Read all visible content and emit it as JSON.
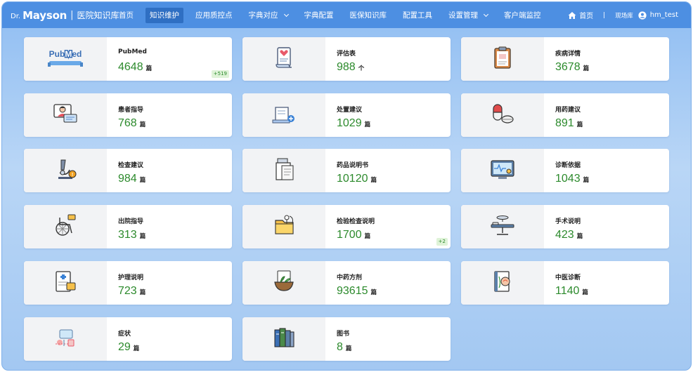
{
  "app": {
    "logo_dr": "Dr.",
    "logo_brand": "Mayson",
    "logo_sep": "|",
    "logo_subtitle": "医院知识库"
  },
  "nav": [
    {
      "label": "首页",
      "active": false,
      "dropdown": false
    },
    {
      "label": "知识维护",
      "active": true,
      "dropdown": false
    },
    {
      "label": "应用质控点",
      "active": false,
      "dropdown": false
    },
    {
      "label": "字典对应",
      "active": false,
      "dropdown": true
    },
    {
      "label": "字典配置",
      "active": false,
      "dropdown": false
    },
    {
      "label": "医保知识库",
      "active": false,
      "dropdown": false
    },
    {
      "label": "配置工具",
      "active": false,
      "dropdown": false
    },
    {
      "label": "设置管理",
      "active": false,
      "dropdown": true
    },
    {
      "label": "客户端监控",
      "active": false,
      "dropdown": false
    }
  ],
  "header_right": {
    "home_label": "首页",
    "site_label": "现场库",
    "username": "hm_test"
  },
  "cards": [
    {
      "title": "PubMed",
      "count": "4648",
      "unit": "篇",
      "delta": "+519",
      "icon": "pubmed-logo-icon"
    },
    {
      "title": "评估表",
      "count": "988",
      "unit": "个",
      "delta": "",
      "icon": "assessment-scroll-icon"
    },
    {
      "title": "疾病详情",
      "count": "3678",
      "unit": "篇",
      "delta": "",
      "icon": "clipboard-icon"
    },
    {
      "title": "患者指导",
      "count": "768",
      "unit": "篇",
      "delta": "",
      "icon": "patient-card-icon"
    },
    {
      "title": "处置建议",
      "count": "1029",
      "unit": "篇",
      "delta": "",
      "icon": "treatment-doc-icon"
    },
    {
      "title": "用药建议",
      "count": "891",
      "unit": "篇",
      "delta": "",
      "icon": "pill-capsule-icon"
    },
    {
      "title": "检查建议",
      "count": "984",
      "unit": "篇",
      "delta": "",
      "icon": "microscope-warning-icon"
    },
    {
      "title": "药品说明书",
      "count": "10120",
      "unit": "篇",
      "delta": "",
      "icon": "drug-leaflet-icon"
    },
    {
      "title": "诊断依据",
      "count": "1043",
      "unit": "篇",
      "delta": "",
      "icon": "monitor-diagnosis-icon"
    },
    {
      "title": "出院指导",
      "count": "313",
      "unit": "篇",
      "delta": "",
      "icon": "wheelchair-icon"
    },
    {
      "title": "检验检查说明",
      "count": "1700",
      "unit": "篇",
      "delta": "+2",
      "icon": "lab-folder-icon"
    },
    {
      "title": "手术说明",
      "count": "423",
      "unit": "篇",
      "delta": "",
      "icon": "operating-table-icon"
    },
    {
      "title": "护理说明",
      "count": "723",
      "unit": "篇",
      "delta": "",
      "icon": "nursing-doc-icon"
    },
    {
      "title": "中药方剂",
      "count": "93615",
      "unit": "篇",
      "delta": "",
      "icon": "herb-mortar-icon"
    },
    {
      "title": "中医诊断",
      "count": "1140",
      "unit": "篇",
      "delta": "",
      "icon": "tcm-book-icon"
    },
    {
      "title": "症状",
      "count": "29",
      "unit": "篇",
      "delta": "",
      "icon": "symptom-icon"
    },
    {
      "title": "图书",
      "count": "8",
      "unit": "篇",
      "delta": "",
      "icon": "books-icon"
    }
  ]
}
